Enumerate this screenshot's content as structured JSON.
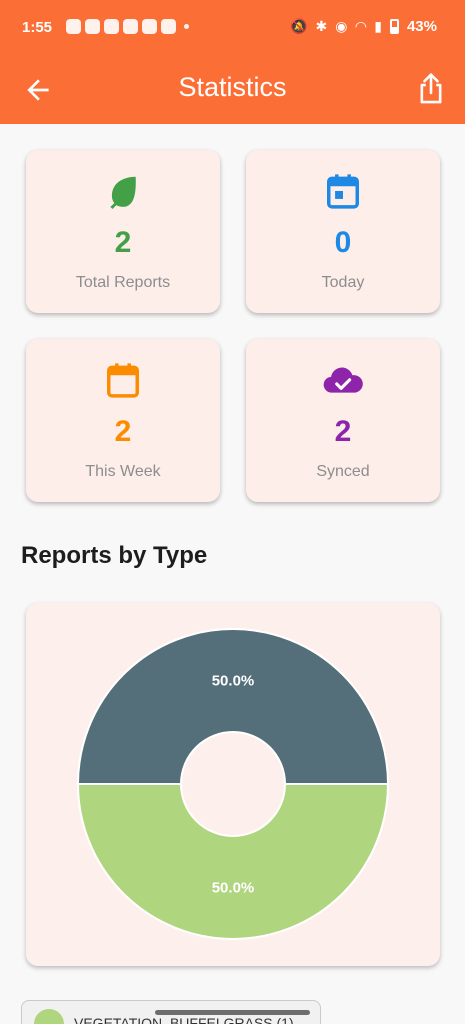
{
  "status_bar": {
    "time": "1:55",
    "battery": "43%",
    "icons": [
      "chat-icon",
      "whatsapp-icon",
      "messenger-icon",
      "messenger-icon",
      "teams-icon",
      "whatsapp-icon",
      "dot-icon",
      "mute-icon",
      "bluetooth-icon",
      "location-icon",
      "wifi-icon",
      "signal-icon",
      "battery-icon"
    ]
  },
  "app_bar": {
    "title": "Statistics",
    "back_icon": "arrow-left-icon",
    "share_icon": "share-icon"
  },
  "stats": [
    {
      "value": "2",
      "label": "Total Reports",
      "icon": "leaf-icon",
      "color": "#43a047"
    },
    {
      "value": "0",
      "label": "Today",
      "icon": "calendar-today-icon",
      "color": "#1e88e5"
    },
    {
      "value": "2",
      "label": "This Week",
      "icon": "calendar-icon",
      "color": "#fb8c00"
    },
    {
      "value": "2",
      "label": "Synced",
      "icon": "cloud-check-icon",
      "color": "#8e24aa"
    }
  ],
  "section_title": "Reports by Type",
  "chart_data": {
    "type": "pie",
    "donut": true,
    "categories": [
      "",
      "VEGETATION_BUFFELGRASS"
    ],
    "values": [
      1,
      1
    ],
    "labels": [
      "50.0%",
      "50.0%"
    ],
    "colors": [
      "#546e7a",
      "#b0d57f"
    ]
  },
  "legend": {
    "items": [
      {
        "label": "VEGETATION_BUFFELGRASS (1)",
        "color": "#b0d57f"
      }
    ]
  }
}
